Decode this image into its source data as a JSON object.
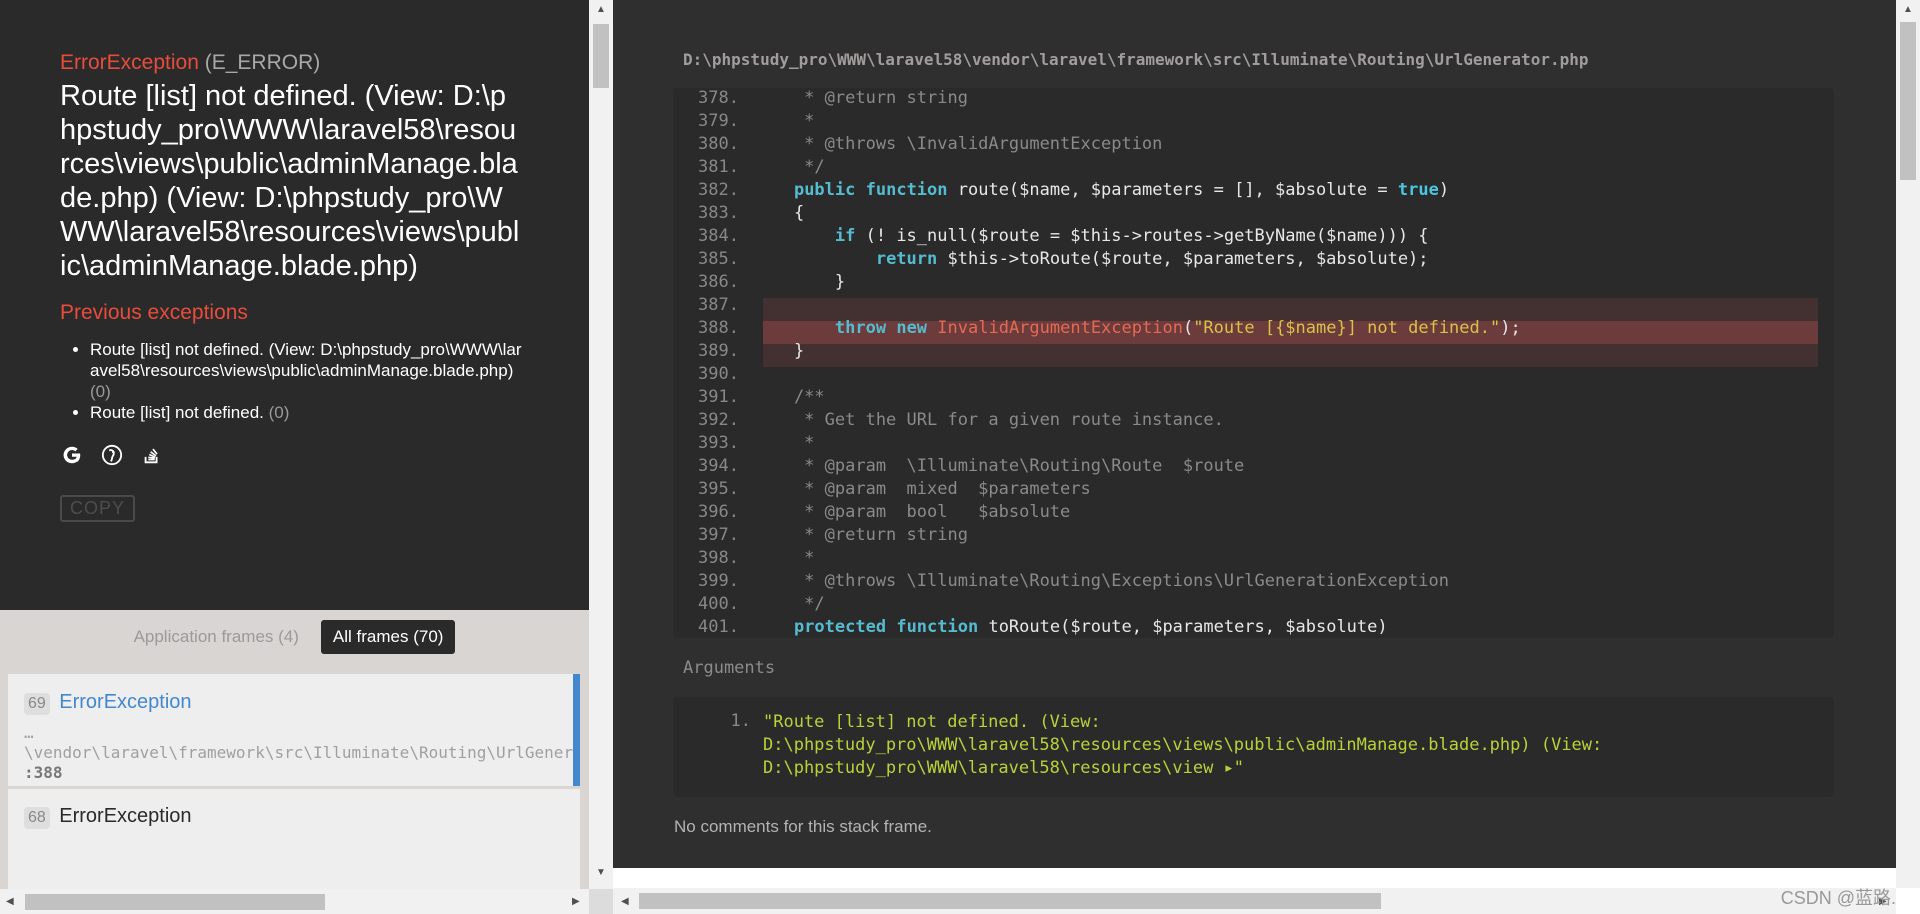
{
  "exception": {
    "type": "ErrorException",
    "code": "(E_ERROR)",
    "message": "Route [list] not defined. (View: D:\\phpstudy_pro\\WWW\\laravel58\\resources\\views\\public\\adminManage.blade.php) (View: D:\\phpstudy_pro\\WWW\\laravel58\\resources\\views\\public\\adminManage.blade.php)",
    "previous_title": "Previous exceptions",
    "previous": [
      {
        "text": "Route [list] not defined. (View: D:\\phpstudy_pro\\WWW\\laravel58\\resources\\views\\public\\adminManage.blade.php)",
        "count": "(0)"
      },
      {
        "text": "Route [list] not defined.",
        "count": "(0)"
      }
    ],
    "search_icons": [
      "google-icon",
      "duckduckgo-icon",
      "stackoverflow-icon"
    ],
    "copy_label": "COPY"
  },
  "filters": {
    "application": "Application frames (4)",
    "all": "All frames (70)"
  },
  "frames": [
    {
      "index": "69",
      "class": "ErrorException",
      "file": "…\n\\vendor\\laravel\\framework\\src\\Illuminate\\Routing\\UrlGenerator.php",
      "line": ":388"
    },
    {
      "index": "68",
      "class": "ErrorException"
    }
  ],
  "code": {
    "file_path": "D:\\phpstudy_pro\\WWW\\laravel58\\vendor\\laravel\\framework\\src\\Illuminate\\Routing\\UrlGenerator.php",
    "lines": [
      {
        "n": "378.",
        "t": "     * @return string"
      },
      {
        "n": "379.",
        "t": "     *"
      },
      {
        "n": "380.",
        "t": "     * @throws \\InvalidArgumentException"
      },
      {
        "n": "381.",
        "t": "     */"
      },
      {
        "n": "382.",
        "t": "    public function route($name, $parameters = [], $absolute = true)"
      },
      {
        "n": "383.",
        "t": "    {"
      },
      {
        "n": "384.",
        "t": "        if (! is_null($route = $this->routes->getByName($name))) {"
      },
      {
        "n": "385.",
        "t": "            return $this->toRoute($route, $parameters, $absolute);"
      },
      {
        "n": "386.",
        "t": "        }"
      },
      {
        "n": "387.",
        "t": ""
      },
      {
        "n": "388.",
        "t": "        throw new InvalidArgumentException(\"Route [{$name}] not defined.\");"
      },
      {
        "n": "389.",
        "t": "    }"
      },
      {
        "n": "390.",
        "t": ""
      },
      {
        "n": "391.",
        "t": "    /**"
      },
      {
        "n": "392.",
        "t": "     * Get the URL for a given route instance."
      },
      {
        "n": "393.",
        "t": "     *"
      },
      {
        "n": "394.",
        "t": "     * @param  \\Illuminate\\Routing\\Route  $route"
      },
      {
        "n": "395.",
        "t": "     * @param  mixed  $parameters"
      },
      {
        "n": "396.",
        "t": "     * @param  bool   $absolute"
      },
      {
        "n": "397.",
        "t": "     * @return string"
      },
      {
        "n": "398.",
        "t": "     *"
      },
      {
        "n": "399.",
        "t": "     * @throws \\Illuminate\\Routing\\Exceptions\\UrlGenerationException"
      },
      {
        "n": "400.",
        "t": "     */"
      },
      {
        "n": "401.",
        "t": "    protected function toRoute($route, $parameters, $absolute)"
      }
    ],
    "error_line": "388."
  },
  "arguments": {
    "title": "Arguments",
    "items": [
      {
        "n": "1.",
        "value": "\"Route [list] not defined. (View:\nD:\\phpstudy_pro\\WWW\\laravel58\\resources\\views\\public\\adminManage.blade.php) (View:\nD:\\phpstudy_pro\\WWW\\laravel58\\resources\\view ▸\""
      }
    ]
  },
  "comments": "No comments for this stack frame.",
  "watermark": "CSDN @蓝路."
}
